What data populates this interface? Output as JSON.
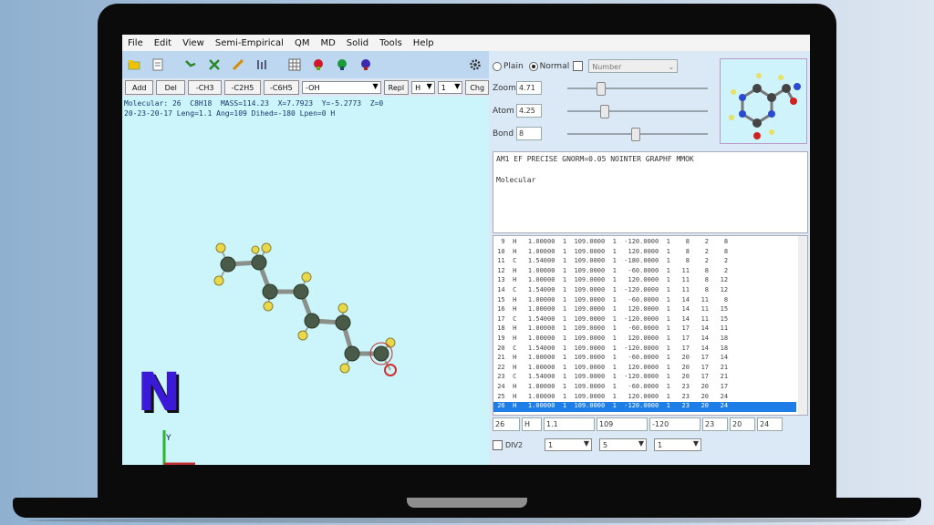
{
  "menu": [
    "File",
    "Edit",
    "View",
    "Semi-Empirical",
    "QM",
    "MD",
    "Solid",
    "Tools",
    "Help"
  ],
  "toolbar": {
    "icons": [
      "open-icon",
      "save-icon",
      "bond-icon",
      "tools-icon",
      "paint-icon",
      "measure-icon",
      "grid-icon",
      "red-molecule-icon",
      "green-molecule-icon",
      "blue-molecule-icon"
    ],
    "settings_icon": "gear-icon"
  },
  "opbar": {
    "add": "Add",
    "del": "Del",
    "ch3": "-CH3",
    "ch2": "-C2H5",
    "ch": "-C6H5",
    "oh": "-OH",
    "repl": "Repl",
    "elem": "H",
    "num": "1",
    "chg": "Chg"
  },
  "info": {
    "line1": "Molecular: 26  C8H18  MASS=114.23  X=7.7923  Y=-5.2773  Z=0",
    "line2": "20-23-20-17 Leng=1.1 Ang=109 Dihed=-180 Lpen=0 H"
  },
  "right": {
    "radio_plain": "Plain",
    "radio_normal": "Normal",
    "number_label": "Number",
    "zoom_label": "Zoom",
    "zoom_value": "4.71",
    "atom_label": "Atom",
    "atom_value": "4.25",
    "bond_label": "Bond",
    "bond_value": "8",
    "keywords": "AM1 EF PRECISE GNORM=0.05 NOINTER GRAPHF MMOK",
    "comment": "Molecular",
    "rows": [
      "  9  H   1.00000  1  109.0000  1  -120.0000  1    8    2    8",
      " 10  H   1.00000  1  109.0000  1   120.0000  1    8    2    8",
      " 11  C   1.54000  1  109.0000  1  -180.0000  1    8    2    2",
      " 12  H   1.00000  1  109.0000  1   -60.0000  1   11    8    2",
      " 13  H   1.00000  1  109.0000  1   120.0000  1   11    8   12",
      " 14  C   1.54000  1  109.0000  1  -120.0000  1   11    8   12",
      " 15  H   1.00000  1  109.0000  1   -60.0000  1   14   11    8",
      " 16  H   1.00000  1  109.0000  1   120.0000  1   14   11   15",
      " 17  C   1.54000  1  109.0000  1  -120.0000  1   14   11   15",
      " 18  H   1.00000  1  109.0000  1   -60.0000  1   17   14   11",
      " 19  H   1.00000  1  109.0000  1   120.0000  1   17   14   18",
      " 20  C   1.54000  1  109.0000  1  -120.0000  1   17   14   18",
      " 21  H   1.00000  1  109.0000  1   -60.0000  1   20   17   14",
      " 22  H   1.00000  1  109.0000  1   120.0000  1   20   17   21",
      " 23  C   1.54000  1  109.0000  1  -120.0000  1   20   17   21",
      " 24  H   1.00000  1  109.0000  1   -60.0000  1   23   20   17",
      " 25  H   1.00000  1  109.0000  1   120.0000  1   23   20   24",
      " 26  H   1.00000  1  109.0000  1  -120.0000  1   23   20   24"
    ],
    "selected_row": 17,
    "edit": [
      "26",
      "H",
      "1.1",
      "109",
      "-120",
      "23",
      "20",
      "24"
    ],
    "bottom": {
      "check_label": "DIV2",
      "c1": "1",
      "c2": "5",
      "c3": "1"
    }
  },
  "viewport": {
    "logo_letter": "N",
    "axis_label": "Y"
  }
}
